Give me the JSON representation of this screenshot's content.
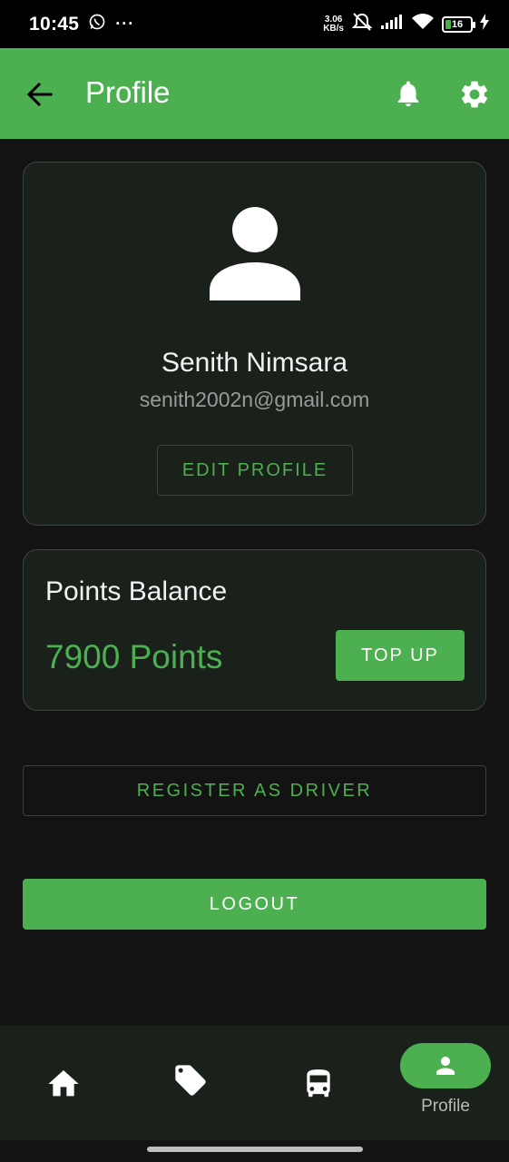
{
  "status_bar": {
    "time": "10:45",
    "more": "···",
    "net_speed_value": "3.06",
    "net_speed_unit": "KB/s",
    "battery_level": "16"
  },
  "app_bar": {
    "title": "Profile",
    "back_icon": "arrow-left-icon",
    "notification_icon": "bell-icon",
    "settings_icon": "gear-icon"
  },
  "profile": {
    "name": "Senith Nimsara",
    "email": "senith2002n@gmail.com",
    "edit_label": "EDIT PROFILE"
  },
  "points": {
    "title": "Points Balance",
    "value": "7900 Points",
    "topup_label": "TOP UP"
  },
  "actions": {
    "register_driver_label": "REGISTER AS DRIVER",
    "logout_label": "LOGOUT"
  },
  "bottom_nav": {
    "items": [
      {
        "icon": "home-icon",
        "label": ""
      },
      {
        "icon": "tags-icon",
        "label": ""
      },
      {
        "icon": "bus-icon",
        "label": ""
      },
      {
        "icon": "person-icon",
        "label": "Profile",
        "active": true
      }
    ]
  },
  "colors": {
    "accent": "#4caf50",
    "background": "#131313",
    "card": "#1a211b"
  }
}
